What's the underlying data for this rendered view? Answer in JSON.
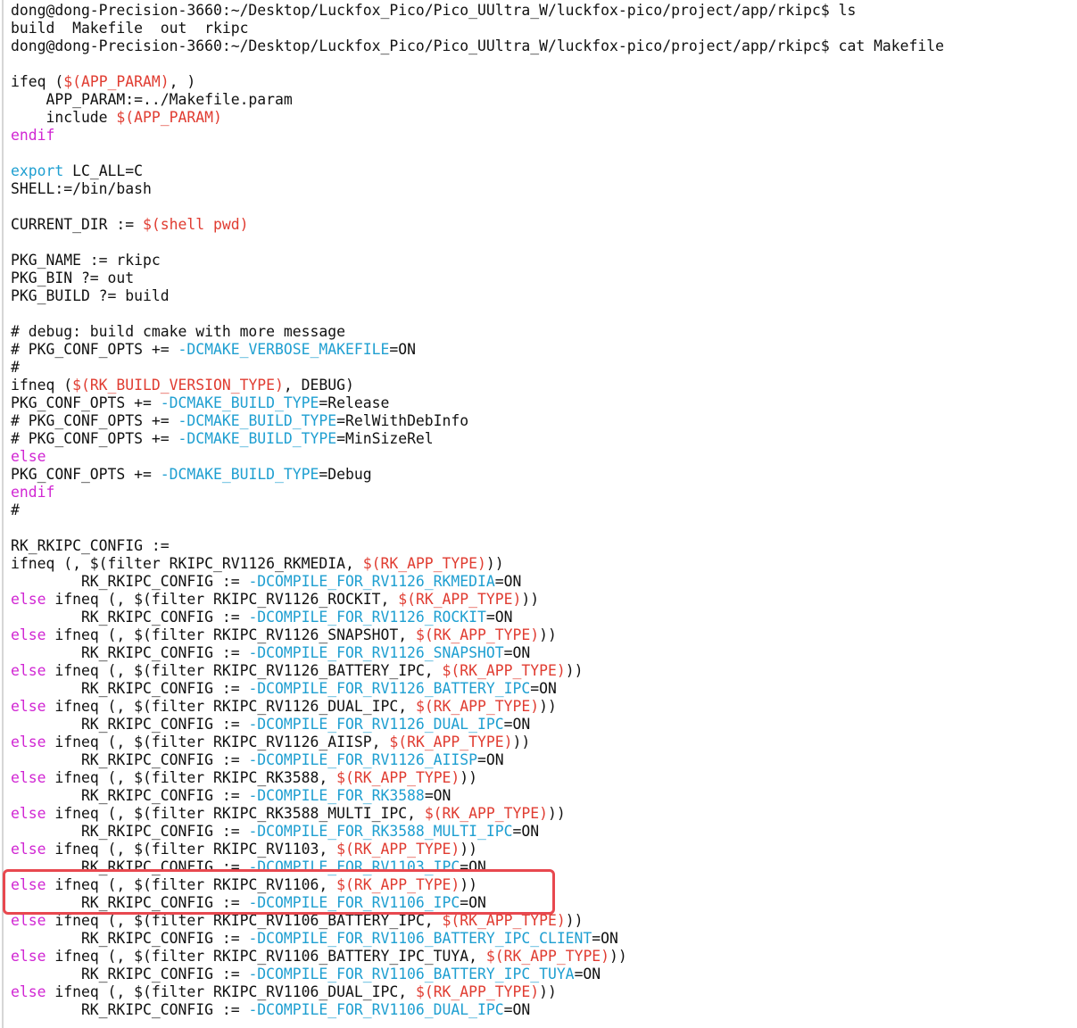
{
  "colors": {
    "background": "#ffffff",
    "text": "#111111",
    "variable": "#e03c31",
    "keyword": "#d127d3",
    "flag": "#1f9fd1",
    "highlight_box": "#e8484f"
  },
  "terminal": {
    "lines": [
      [
        {
          "t": "plain",
          "s": "dong@dong-Precision-3660:~/Desktop/Luckfox_Pico/Pico_UUltra_W/luckfox-pico/project/app/rkipc$ ls"
        }
      ],
      [
        {
          "t": "plain",
          "s": "build  Makefile  out  rkipc"
        }
      ],
      [
        {
          "t": "plain",
          "s": "dong@dong-Precision-3660:~/Desktop/Luckfox_Pico/Pico_UUltra_W/luckfox-pico/project/app/rkipc$ cat Makefile"
        }
      ],
      [],
      [
        {
          "t": "plain",
          "s": "ifeq ("
        },
        {
          "t": "var",
          "s": "$(APP_PARAM)"
        },
        {
          "t": "plain",
          "s": ", )"
        }
      ],
      [
        {
          "t": "plain",
          "s": "    APP_PARAM:=../Makefile.param"
        }
      ],
      [
        {
          "t": "plain",
          "s": "    include "
        },
        {
          "t": "var",
          "s": "$(APP_PARAM)"
        }
      ],
      [
        {
          "t": "kw",
          "s": "endif"
        }
      ],
      [],
      [
        {
          "t": "export",
          "s": "export"
        },
        {
          "t": "plain",
          "s": " LC_ALL=C"
        }
      ],
      [
        {
          "t": "plain",
          "s": "SHELL:=/bin/bash"
        }
      ],
      [],
      [
        {
          "t": "plain",
          "s": "CURRENT_DIR := "
        },
        {
          "t": "var",
          "s": "$(shell pwd)"
        }
      ],
      [],
      [
        {
          "t": "plain",
          "s": "PKG_NAME := rkipc"
        }
      ],
      [
        {
          "t": "plain",
          "s": "PKG_BIN ?= out"
        }
      ],
      [
        {
          "t": "plain",
          "s": "PKG_BUILD ?= build"
        }
      ],
      [],
      [
        {
          "t": "plain",
          "s": "# debug: build cmake with more message"
        }
      ],
      [
        {
          "t": "plain",
          "s": "# PKG_CONF_OPTS += "
        },
        {
          "t": "flag",
          "s": "-DCMAKE_VERBOSE_MAKEFILE"
        },
        {
          "t": "plain",
          "s": "=ON"
        }
      ],
      [
        {
          "t": "plain",
          "s": "#"
        }
      ],
      [
        {
          "t": "plain",
          "s": "ifneq ("
        },
        {
          "t": "var",
          "s": "$(RK_BUILD_VERSION_TYPE)"
        },
        {
          "t": "plain",
          "s": ", DEBUG)"
        }
      ],
      [
        {
          "t": "plain",
          "s": "PKG_CONF_OPTS += "
        },
        {
          "t": "flag",
          "s": "-DCMAKE_BUILD_TYPE"
        },
        {
          "t": "plain",
          "s": "=Release"
        }
      ],
      [
        {
          "t": "plain",
          "s": "# PKG_CONF_OPTS += "
        },
        {
          "t": "flag",
          "s": "-DCMAKE_BUILD_TYPE"
        },
        {
          "t": "plain",
          "s": "=RelWithDebInfo"
        }
      ],
      [
        {
          "t": "plain",
          "s": "# PKG_CONF_OPTS += "
        },
        {
          "t": "flag",
          "s": "-DCMAKE_BUILD_TYPE"
        },
        {
          "t": "plain",
          "s": "=MinSizeRel"
        }
      ],
      [
        {
          "t": "kw",
          "s": "else"
        }
      ],
      [
        {
          "t": "plain",
          "s": "PKG_CONF_OPTS += "
        },
        {
          "t": "flag",
          "s": "-DCMAKE_BUILD_TYPE"
        },
        {
          "t": "plain",
          "s": "=Debug"
        }
      ],
      [
        {
          "t": "kw",
          "s": "endif"
        }
      ],
      [
        {
          "t": "plain",
          "s": "#"
        }
      ],
      [],
      [
        {
          "t": "plain",
          "s": "RK_RKIPC_CONFIG :="
        }
      ],
      [
        {
          "t": "plain",
          "s": "ifneq (, $(filter RKIPC_RV1126_RKMEDIA, "
        },
        {
          "t": "var",
          "s": "$(RK_APP_TYPE)"
        },
        {
          "t": "plain",
          "s": "))"
        }
      ],
      [
        {
          "t": "plain",
          "s": "        RK_RKIPC_CONFIG := "
        },
        {
          "t": "flag",
          "s": "-DCOMPILE_FOR_RV1126_RKMEDIA"
        },
        {
          "t": "plain",
          "s": "=ON"
        }
      ],
      [
        {
          "t": "kw",
          "s": "else"
        },
        {
          "t": "plain",
          "s": " ifneq (, $(filter RKIPC_RV1126_ROCKIT, "
        },
        {
          "t": "var",
          "s": "$(RK_APP_TYPE)"
        },
        {
          "t": "plain",
          "s": "))"
        }
      ],
      [
        {
          "t": "plain",
          "s": "        RK_RKIPC_CONFIG := "
        },
        {
          "t": "flag",
          "s": "-DCOMPILE_FOR_RV1126_ROCKIT"
        },
        {
          "t": "plain",
          "s": "=ON"
        }
      ],
      [
        {
          "t": "kw",
          "s": "else"
        },
        {
          "t": "plain",
          "s": " ifneq (, $(filter RKIPC_RV1126_SNAPSHOT, "
        },
        {
          "t": "var",
          "s": "$(RK_APP_TYPE)"
        },
        {
          "t": "plain",
          "s": "))"
        }
      ],
      [
        {
          "t": "plain",
          "s": "        RK_RKIPC_CONFIG := "
        },
        {
          "t": "flag",
          "s": "-DCOMPILE_FOR_RV1126_SNAPSHOT"
        },
        {
          "t": "plain",
          "s": "=ON"
        }
      ],
      [
        {
          "t": "kw",
          "s": "else"
        },
        {
          "t": "plain",
          "s": " ifneq (, $(filter RKIPC_RV1126_BATTERY_IPC, "
        },
        {
          "t": "var",
          "s": "$(RK_APP_TYPE)"
        },
        {
          "t": "plain",
          "s": "))"
        }
      ],
      [
        {
          "t": "plain",
          "s": "        RK_RKIPC_CONFIG := "
        },
        {
          "t": "flag",
          "s": "-DCOMPILE_FOR_RV1126_BATTERY_IPC"
        },
        {
          "t": "plain",
          "s": "=ON"
        }
      ],
      [
        {
          "t": "kw",
          "s": "else"
        },
        {
          "t": "plain",
          "s": " ifneq (, $(filter RKIPC_RV1126_DUAL_IPC, "
        },
        {
          "t": "var",
          "s": "$(RK_APP_TYPE)"
        },
        {
          "t": "plain",
          "s": "))"
        }
      ],
      [
        {
          "t": "plain",
          "s": "        RK_RKIPC_CONFIG := "
        },
        {
          "t": "flag",
          "s": "-DCOMPILE_FOR_RV1126_DUAL_IPC"
        },
        {
          "t": "plain",
          "s": "=ON"
        }
      ],
      [
        {
          "t": "kw",
          "s": "else"
        },
        {
          "t": "plain",
          "s": " ifneq (, $(filter RKIPC_RV1126_AIISP, "
        },
        {
          "t": "var",
          "s": "$(RK_APP_TYPE)"
        },
        {
          "t": "plain",
          "s": "))"
        }
      ],
      [
        {
          "t": "plain",
          "s": "        RK_RKIPC_CONFIG := "
        },
        {
          "t": "flag",
          "s": "-DCOMPILE_FOR_RV1126_AIISP"
        },
        {
          "t": "plain",
          "s": "=ON"
        }
      ],
      [
        {
          "t": "kw",
          "s": "else"
        },
        {
          "t": "plain",
          "s": " ifneq (, $(filter RKIPC_RK3588, "
        },
        {
          "t": "var",
          "s": "$(RK_APP_TYPE)"
        },
        {
          "t": "plain",
          "s": "))"
        }
      ],
      [
        {
          "t": "plain",
          "s": "        RK_RKIPC_CONFIG := "
        },
        {
          "t": "flag",
          "s": "-DCOMPILE_FOR_RK3588"
        },
        {
          "t": "plain",
          "s": "=ON"
        }
      ],
      [
        {
          "t": "kw",
          "s": "else"
        },
        {
          "t": "plain",
          "s": " ifneq (, $(filter RKIPC_RK3588_MULTI_IPC, "
        },
        {
          "t": "var",
          "s": "$(RK_APP_TYPE)"
        },
        {
          "t": "plain",
          "s": "))"
        }
      ],
      [
        {
          "t": "plain",
          "s": "        RK_RKIPC_CONFIG := "
        },
        {
          "t": "flag",
          "s": "-DCOMPILE_FOR_RK3588_MULTI_IPC"
        },
        {
          "t": "plain",
          "s": "=ON"
        }
      ],
      [
        {
          "t": "kw",
          "s": "else"
        },
        {
          "t": "plain",
          "s": " ifneq (, $(filter RKIPC_RV1103, "
        },
        {
          "t": "var",
          "s": "$(RK_APP_TYPE)"
        },
        {
          "t": "plain",
          "s": "))"
        }
      ],
      [
        {
          "t": "plain",
          "s": "        RK_RKIPC_CONFIG := "
        },
        {
          "t": "flag",
          "s": "-DCOMPILE_FOR_RV1103_IPC"
        },
        {
          "t": "plain",
          "s": "=ON"
        }
      ],
      [
        {
          "t": "kw",
          "s": "else"
        },
        {
          "t": "plain",
          "s": " ifneq (, $(filter RKIPC_RV1106, "
        },
        {
          "t": "var",
          "s": "$(RK_APP_TYPE)"
        },
        {
          "t": "plain",
          "s": "))"
        }
      ],
      [
        {
          "t": "plain",
          "s": "        RK_RKIPC_CONFIG := "
        },
        {
          "t": "flag",
          "s": "-DCOMPILE_FOR_RV1106_IPC"
        },
        {
          "t": "plain",
          "s": "=ON"
        }
      ],
      [
        {
          "t": "kw",
          "s": "else"
        },
        {
          "t": "plain",
          "s": " ifneq (, $(filter RKIPC_RV1106_BATTERY_IPC, "
        },
        {
          "t": "var",
          "s": "$(RK_APP_TYPE)"
        },
        {
          "t": "plain",
          "s": "))"
        }
      ],
      [
        {
          "t": "plain",
          "s": "        RK_RKIPC_CONFIG := "
        },
        {
          "t": "flag",
          "s": "-DCOMPILE_FOR_RV1106_BATTERY_IPC_CLIENT"
        },
        {
          "t": "plain",
          "s": "=ON"
        }
      ],
      [
        {
          "t": "kw",
          "s": "else"
        },
        {
          "t": "plain",
          "s": " ifneq (, $(filter RKIPC_RV1106_BATTERY_IPC_TUYA, "
        },
        {
          "t": "var",
          "s": "$(RK_APP_TYPE)"
        },
        {
          "t": "plain",
          "s": "))"
        }
      ],
      [
        {
          "t": "plain",
          "s": "        RK_RKIPC_CONFIG := "
        },
        {
          "t": "flag",
          "s": "-DCOMPILE_FOR_RV1106_BATTERY_IPC_TUYA"
        },
        {
          "t": "plain",
          "s": "=ON"
        }
      ],
      [
        {
          "t": "kw",
          "s": "else"
        },
        {
          "t": "plain",
          "s": " ifneq (, $(filter RKIPC_RV1106_DUAL_IPC, "
        },
        {
          "t": "var",
          "s": "$(RK_APP_TYPE)"
        },
        {
          "t": "plain",
          "s": "))"
        }
      ],
      [
        {
          "t": "plain",
          "s": "        RK_RKIPC_CONFIG := "
        },
        {
          "t": "flag",
          "s": "-DCOMPILE_FOR_RV1106_DUAL_IPC"
        },
        {
          "t": "plain",
          "s": "=ON"
        }
      ]
    ]
  }
}
